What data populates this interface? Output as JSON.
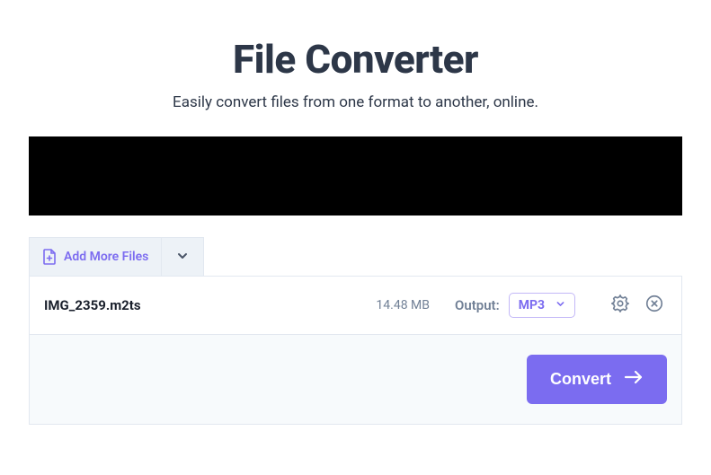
{
  "header": {
    "title": "File Converter",
    "subtitle": "Easily convert files from one format to another, online."
  },
  "toolbar": {
    "add_more_label": "Add More Files"
  },
  "file": {
    "name": "IMG_2359.m2ts",
    "size": "14.48 MB",
    "output_label": "Output:",
    "output_format": "MP3"
  },
  "actions": {
    "convert_label": "Convert"
  },
  "colors": {
    "accent": "#7b6cf0",
    "text_dark": "#2d3748",
    "text_muted": "#718096"
  }
}
